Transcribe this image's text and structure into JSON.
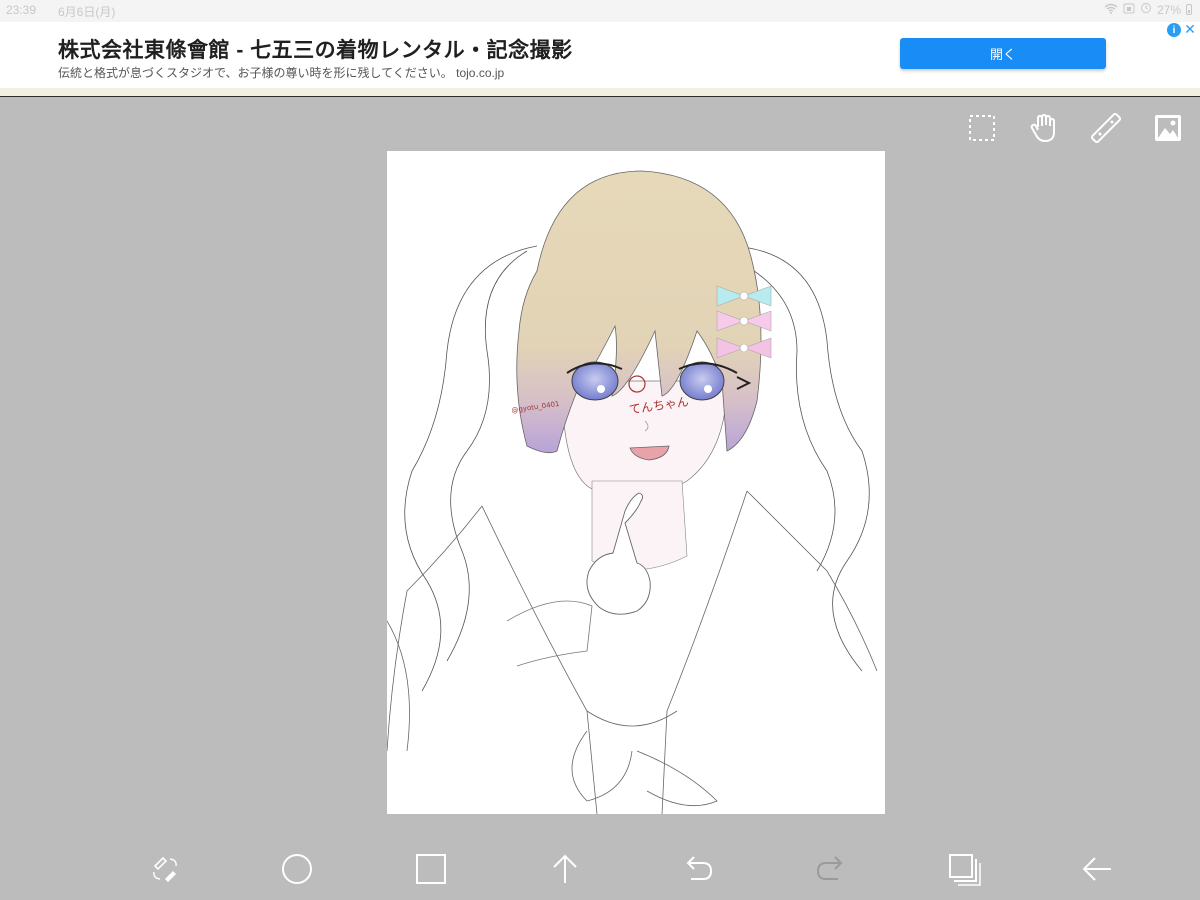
{
  "status_bar": {
    "time": "23:39",
    "date": "6月6日(月)",
    "battery": "27%"
  },
  "ad": {
    "title": "株式会社東條會館 - 七五三の着物レンタル・記念撮影",
    "description": "伝統と格式が息づくスタジオで、お子様の尊い時を形に残してください。 tojo.co.jp",
    "open_button": "開く",
    "info_icon": "info-icon",
    "close_icon": "close-icon",
    "accent_color": "#1a8cf5"
  },
  "top_tools": [
    {
      "name": "selection-icon"
    },
    {
      "name": "hand-move-icon"
    },
    {
      "name": "ruler-icon"
    },
    {
      "name": "material-image-icon"
    }
  ],
  "artwork": {
    "signature": "@gyotu_0401",
    "stamp_text": "てんちゃん",
    "hair_color_top": "#e6d9b8",
    "hair_color_bottom": "#b8a3d9",
    "eye_color": "#7f86d6",
    "bow_colors": [
      "#b6ecef",
      "#f7c9ea",
      "#f3c2e4"
    ]
  },
  "bottom_tools": [
    {
      "name": "pen-eraser-toggle-icon"
    },
    {
      "name": "circle-icon"
    },
    {
      "name": "square-icon"
    },
    {
      "name": "up-arrow-icon"
    },
    {
      "name": "undo-icon"
    },
    {
      "name": "redo-icon"
    },
    {
      "name": "layers-icon"
    },
    {
      "name": "back-arrow-icon"
    }
  ],
  "colors": {
    "workspace_bg": "#bcbcbc",
    "canvas_bg": "#ffffff"
  }
}
